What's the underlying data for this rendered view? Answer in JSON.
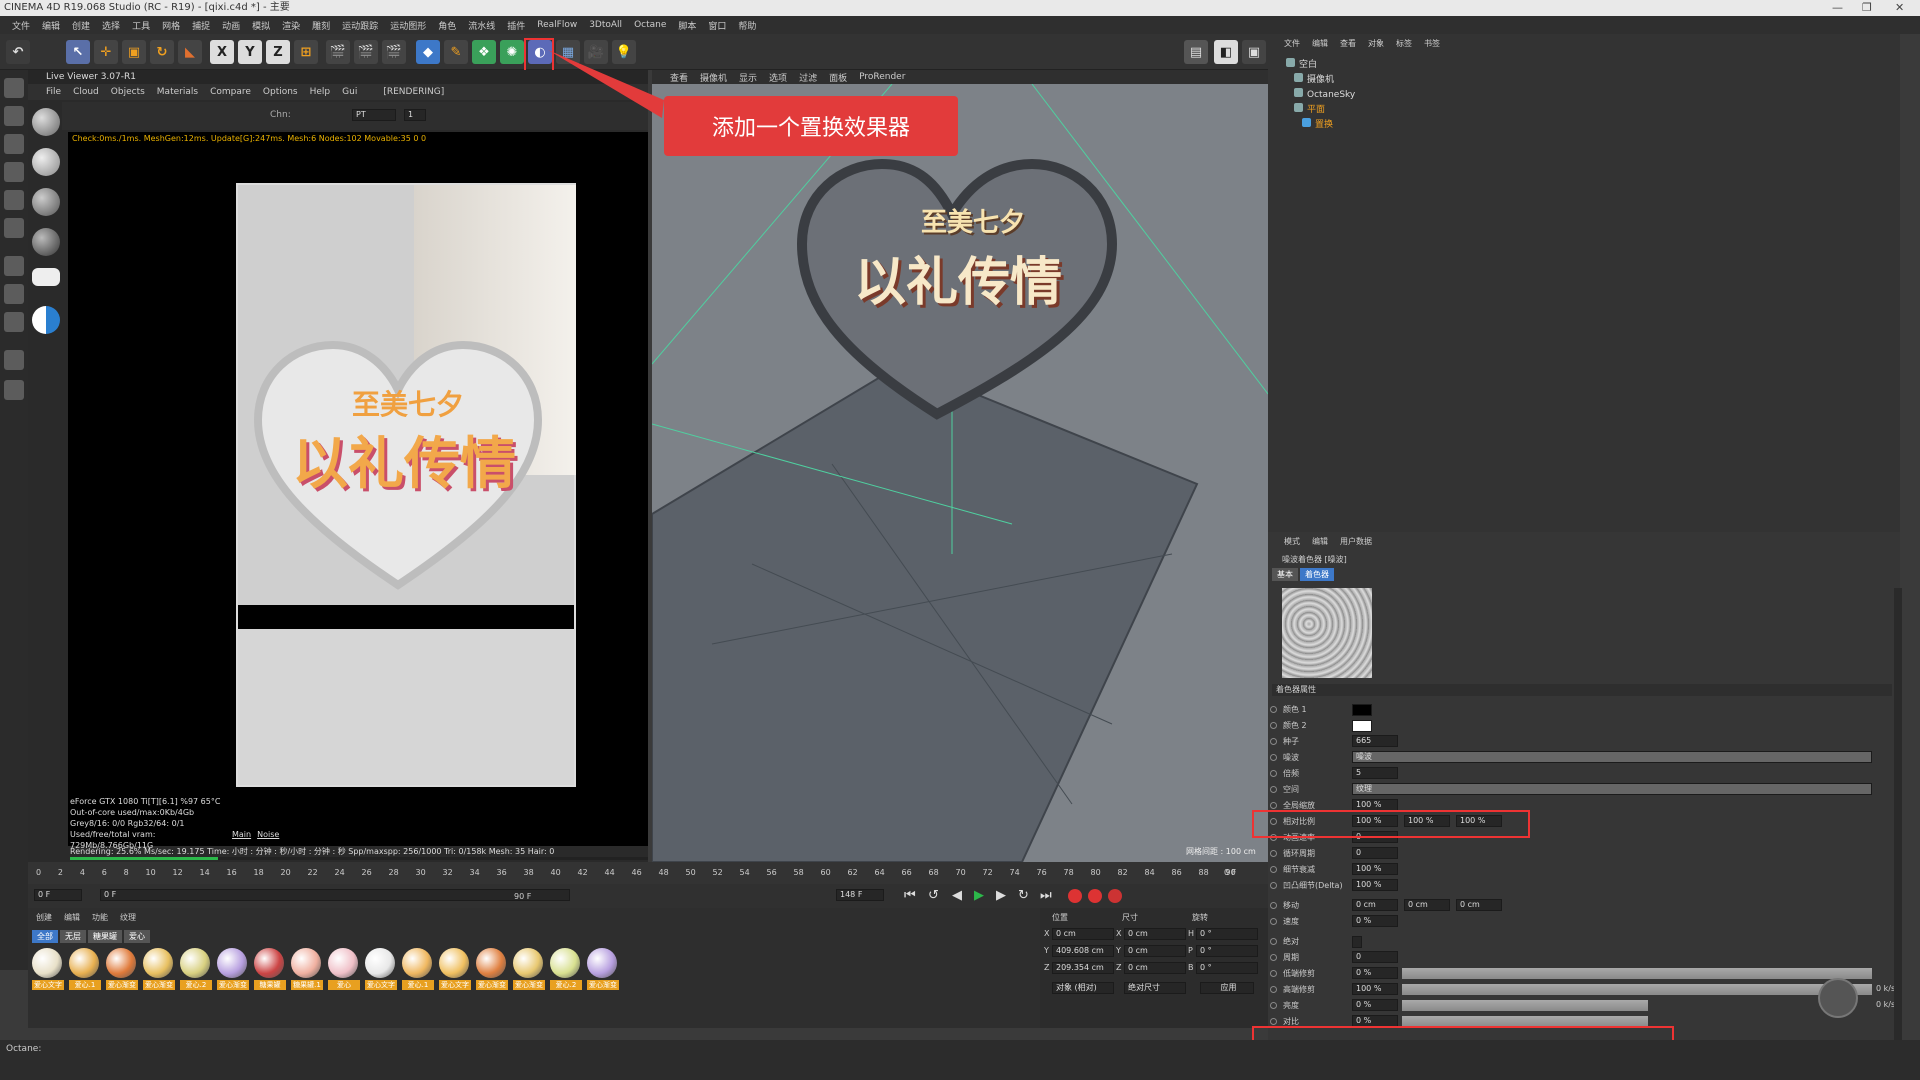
{
  "window_title": "CINEMA 4D R19.068 Studio (RC - R19) - [qixi.c4d *] - 主要",
  "menu": [
    "文件",
    "编辑",
    "创建",
    "选择",
    "工具",
    "网格",
    "捕捉",
    "动画",
    "模拟",
    "渲染",
    "雕刻",
    "运动跟踪",
    "运动图形",
    "角色",
    "流水线",
    "插件",
    "RealFlow",
    "3DtoAll",
    "Octane",
    "脚本",
    "窗口",
    "帮助"
  ],
  "toolbar": {
    "undo": "↶",
    "x": "X",
    "y": "Y",
    "z": "Z"
  },
  "live_viewer": {
    "title": "Live Viewer 3.07-R1",
    "menu": [
      "File",
      "Cloud",
      "Objects",
      "Materials",
      "Compare",
      "Options",
      "Help",
      "Gui"
    ],
    "state": "[RENDERING]",
    "chn_label": "Chn:",
    "chn_value": "PT",
    "chn_num": "1",
    "check_line": "Check:0ms./1ms. MeshGen:12ms. Update[G]:247ms. Mesh:6 Nodes:102 Movable:35 0 0",
    "stats": [
      "eForce GTX 1080 Ti[T][6.1]  %97     65°C",
      "Out-of-core used/max:0Kb/4Gb",
      "Grey8/16: 0/0          Rgb32/64: 0/1",
      "Used/free/total vram: 729Mb/8.766Gb/11G"
    ],
    "tabs": [
      "Main",
      "Noise"
    ],
    "render_line": "Rendering: 25.6%   Ms/sec: 19.175   Time: 小时 : 分钟 : 秒/小时 : 分钟 : 秒   Spp/maxspp: 256/1000   Tri: 0/158k   Mesh: 35   Hair: 0",
    "render_title_top": "至美七夕",
    "render_title_main": "以礼传情"
  },
  "viewport": {
    "menu": [
      "查看",
      "摄像机",
      "显示",
      "选项",
      "过滤",
      "面板",
      "ProRender"
    ],
    "title_top": "至美七夕",
    "title_main": "以礼传情",
    "grid_spacing": "网格间距 : 100 cm"
  },
  "callout": "添加一个置换效果器",
  "timeline": {
    "ticks": [
      "0",
      "2",
      "4",
      "6",
      "8",
      "10",
      "12",
      "14",
      "16",
      "18",
      "20",
      "22",
      "24",
      "26",
      "28",
      "30",
      "32",
      "34",
      "36",
      "38",
      "40",
      "42",
      "44",
      "46",
      "48",
      "50",
      "52",
      "54",
      "56",
      "58",
      "60",
      "62",
      "64",
      "66",
      "68",
      "70",
      "72",
      "74",
      "76",
      "78",
      "80",
      "82",
      "84",
      "86",
      "88",
      "90"
    ],
    "frame_end": "0 F",
    "start": "0 F",
    "start2": "0 F",
    "end_field": "90 F",
    "end_field2": "148 F"
  },
  "material_manager": {
    "menu": [
      "创建",
      "编辑",
      "功能",
      "纹理"
    ],
    "filters": [
      "全部",
      "无层",
      "糖果罐",
      "爱心"
    ],
    "swatches": [
      {
        "label": "爱心文字",
        "color": "#e8e0c8"
      },
      {
        "label": "爱心.1",
        "color": "#e8b050"
      },
      {
        "label": "爱心渐变",
        "color": "#e07a3a"
      },
      {
        "label": "爱心渐变",
        "color": "#e8c060"
      },
      {
        "label": "爱心.2",
        "color": "#d8d080"
      },
      {
        "label": "爱心渐变",
        "color": "#b8a0e0"
      },
      {
        "label": "糖果罐",
        "color": "#cc4444"
      },
      {
        "label": "糖果罐.1",
        "color": "#f0b0a0"
      },
      {
        "label": "爱心",
        "color": "#f0c0c8"
      },
      {
        "label": "爱心文字",
        "color": "#e8e8e8"
      },
      {
        "label": "爱心.1",
        "color": "#f0b860"
      },
      {
        "label": "爱心文字",
        "color": "#f0c060"
      },
      {
        "label": "爱心渐变",
        "color": "#e08040"
      },
      {
        "label": "爱心渐变",
        "color": "#e8c870"
      },
      {
        "label": "爱心.2",
        "color": "#d8e090"
      },
      {
        "label": "爱心渐变",
        "color": "#b8a0e0"
      }
    ]
  },
  "coords": {
    "headers": [
      "位置",
      "尺寸",
      "旋转"
    ],
    "rows": [
      {
        "axis": "X",
        "pos": "0 cm",
        "size_axis": "X",
        "size": "0 cm",
        "rot_axis": "H",
        "rot": "0 °"
      },
      {
        "axis": "Y",
        "pos": "409.608 cm",
        "size_axis": "Y",
        "size": "0 cm",
        "rot_axis": "P",
        "rot": "0 °"
      },
      {
        "axis": "Z",
        "pos": "209.354 cm",
        "size_axis": "Z",
        "size": "0 cm",
        "rot_axis": "B",
        "rot": "0 °"
      }
    ],
    "mode1": "对象 (相对)",
    "mode2": "绝对尺寸",
    "apply": "应用"
  },
  "object_manager": {
    "menu": [
      "文件",
      "编辑",
      "查看",
      "对象",
      "标签",
      "书签"
    ],
    "items": [
      "空白",
      "摄像机",
      "OctaneSky",
      "平面",
      "置换"
    ]
  },
  "attributes": {
    "menu": [
      "模式",
      "编辑",
      "用户数据"
    ],
    "title": "噪波着色器 [噪波]",
    "tabs": [
      "基本",
      "着色器"
    ],
    "section": "着色器属性",
    "rows": [
      {
        "label": "颜色 1",
        "value": ""
      },
      {
        "label": "颜色 2",
        "value": ""
      },
      {
        "label": "种子",
        "value": "665"
      },
      {
        "label": "噪波",
        "value": "噪波"
      },
      {
        "label": "倍频",
        "value": "5"
      },
      {
        "label": "空间",
        "value": "纹理"
      },
      {
        "label": "全局缩放",
        "value": "100 %"
      },
      {
        "label": "相对比例",
        "value": "100 %",
        "v2": "100 %",
        "v3": "100 %"
      },
      {
        "label": "动画速率",
        "value": "0"
      },
      {
        "label": "循环周期",
        "value": "0"
      },
      {
        "label": "细节衰减",
        "value": "100 %"
      },
      {
        "label": "凹凸细节(Delta)",
        "value": "100 %"
      },
      {
        "label": "移动",
        "value": "0 cm",
        "v2": "0 cm",
        "v3": "0 cm"
      },
      {
        "label": "速度",
        "value": "0 %"
      },
      {
        "label": "绝对",
        "value": ""
      },
      {
        "label": "周期",
        "value": "0"
      },
      {
        "label": "低端修剪",
        "value": "0 %"
      },
      {
        "label": "高端修剪",
        "value": "100 %"
      },
      {
        "label": "亮度",
        "value": "0 %"
      },
      {
        "label": "对比",
        "value": "0 %"
      }
    ],
    "speed_top": "0 k/s",
    "speed_bottom": "0 k/s"
  },
  "status": "Octane:"
}
